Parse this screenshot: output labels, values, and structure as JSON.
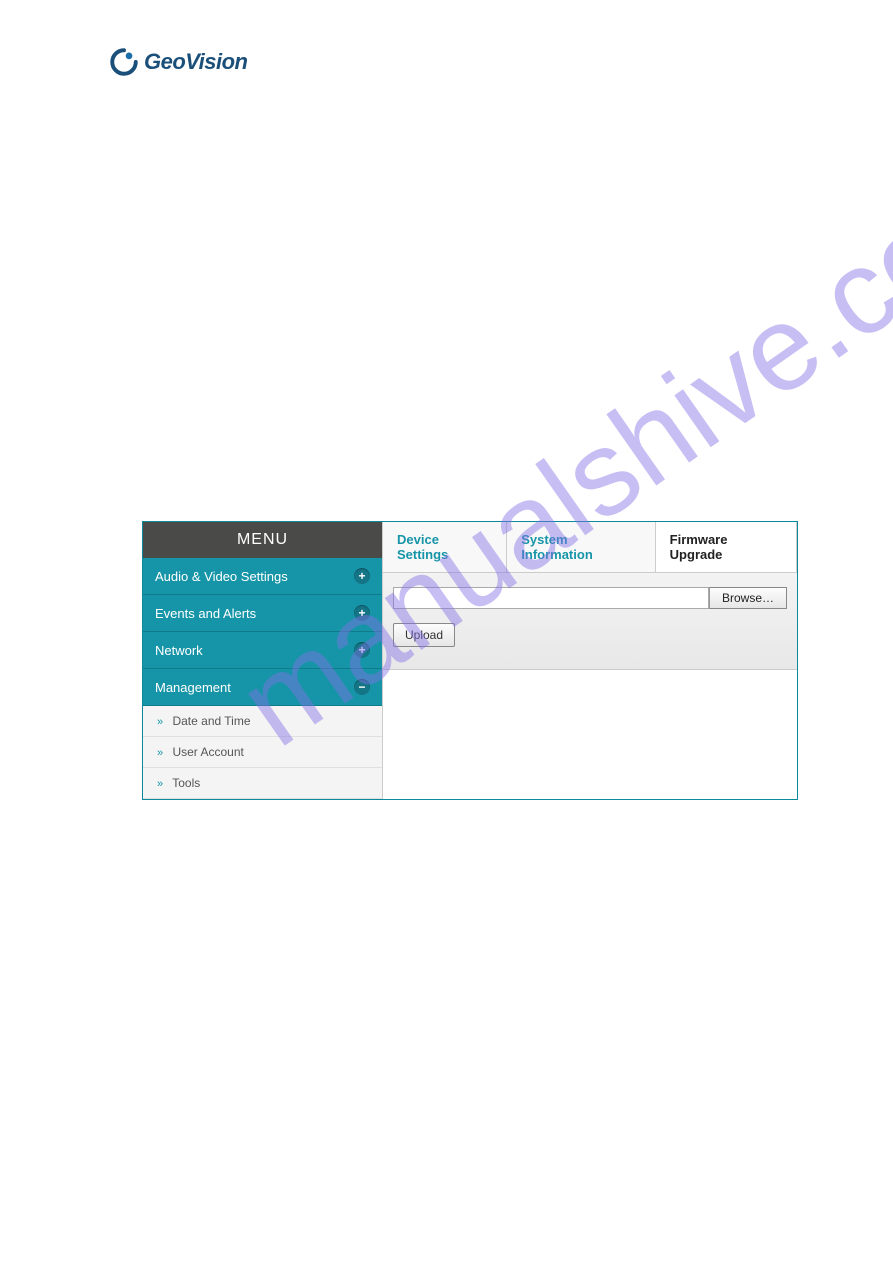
{
  "logo": {
    "brand_text": "GeoVision"
  },
  "watermark": {
    "text": "manualshive.com"
  },
  "sidebar": {
    "header": "MENU",
    "items": [
      {
        "label": "Audio & Video Settings",
        "icon": "plus"
      },
      {
        "label": "Events and Alerts",
        "icon": "plus"
      },
      {
        "label": "Network",
        "icon": "plus"
      },
      {
        "label": "Management",
        "icon": "minus"
      }
    ],
    "subitems": [
      {
        "label": "Date and Time"
      },
      {
        "label": "User Account"
      },
      {
        "label": "Tools"
      }
    ]
  },
  "tabs": {
    "items": [
      {
        "label": "Device Settings",
        "active": false
      },
      {
        "label": "System Information",
        "active": false
      },
      {
        "label": "Firmware Upgrade",
        "active": true
      }
    ]
  },
  "form": {
    "file_value": "",
    "browse_label": "Browse…",
    "upload_label": "Upload"
  }
}
